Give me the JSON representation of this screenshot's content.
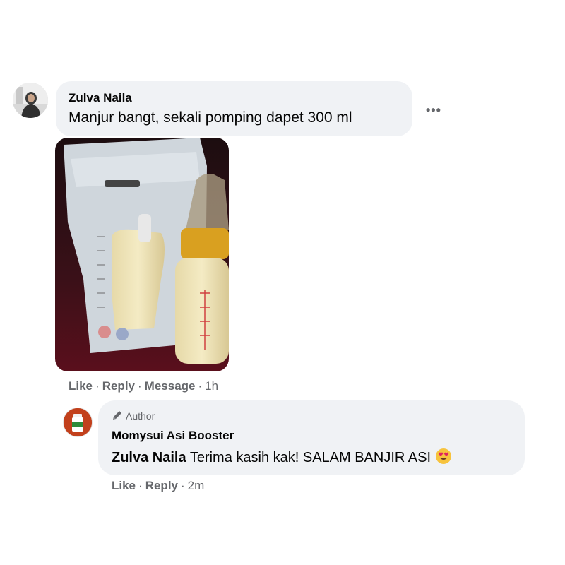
{
  "comment": {
    "author": "Zulva Naila",
    "text": "Manjur bangt, sekali pomping dapet 300 ml",
    "more_label": "•••",
    "actions": {
      "like": "Like",
      "reply": "Reply",
      "message": "Message",
      "time": "1h"
    }
  },
  "reply": {
    "badge": "Author",
    "author": "Momysui Asi Booster",
    "mention": "Zulva Naila",
    "text": "Terima kasih kak! SALAM BANJIR ASI",
    "emoji": "heart-eyes-emoji",
    "actions": {
      "like": "Like",
      "reply": "Reply",
      "time": "2m"
    }
  },
  "colors": {
    "bubble": "#f0f2f5",
    "meta": "#65676b",
    "text": "#050505",
    "page_avatar": "#c2401c"
  }
}
